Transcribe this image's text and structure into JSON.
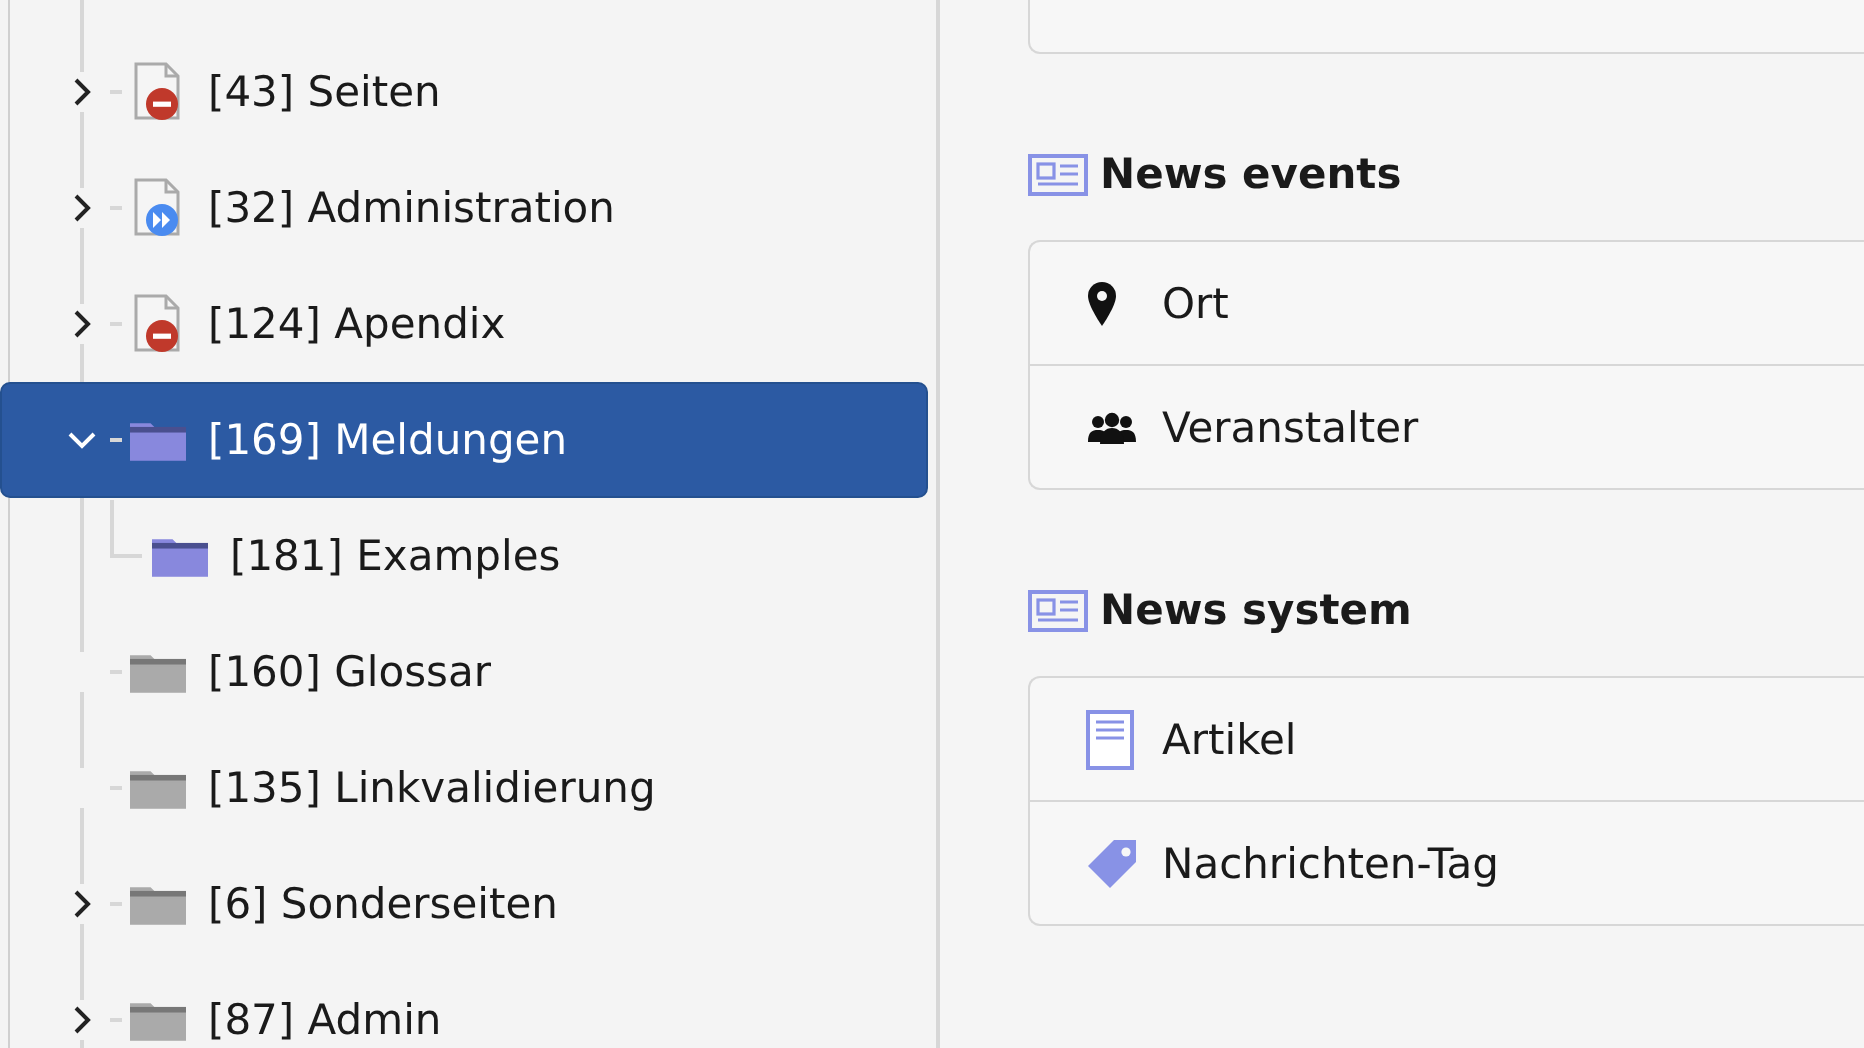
{
  "page_tree": {
    "nodes": [
      {
        "label": "[43] Seiten",
        "kind": "page-hidden",
        "expanded": false,
        "selected": false
      },
      {
        "label": "[32] Administration",
        "kind": "page-shortcut",
        "expanded": false,
        "selected": false
      },
      {
        "label": "[124] Apendix",
        "kind": "page-hidden",
        "expanded": false,
        "selected": false
      },
      {
        "label": "[169] Meldungen",
        "kind": "news-folder",
        "expanded": true,
        "selected": true,
        "children": [
          {
            "label": "[181] Examples",
            "kind": "news-folder",
            "selected": false
          }
        ]
      },
      {
        "label": "[160] Glossar",
        "kind": "folder",
        "selected": false
      },
      {
        "label": "[135] Linkvalidierung",
        "kind": "folder",
        "selected": false
      },
      {
        "label": "[6] Sonderseiten",
        "kind": "folder",
        "expanded": false,
        "selected": false
      },
      {
        "label": "[87] Admin",
        "kind": "folder",
        "expanded": false,
        "selected": false
      }
    ]
  },
  "record_groups": [
    {
      "title": "News events",
      "items": [
        {
          "label": "Ort",
          "kind": "pin"
        },
        {
          "label": "Veranstalter",
          "kind": "people"
        }
      ]
    },
    {
      "title": "News system",
      "items": [
        {
          "label": "Artikel",
          "kind": "document"
        },
        {
          "label": "Nachrichten-Tag",
          "kind": "tag"
        }
      ]
    }
  ]
}
